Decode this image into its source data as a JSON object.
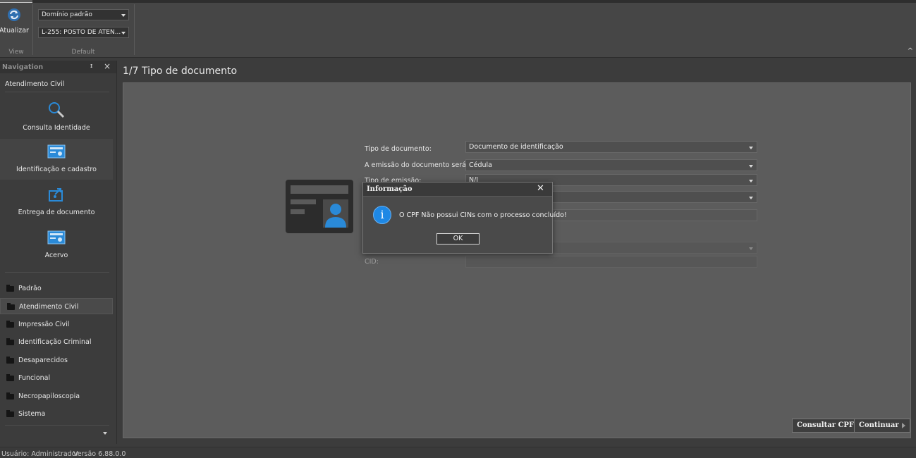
{
  "ribbon": {
    "refresh_label": "Atualizar",
    "view_group_label": "View",
    "default_group_label": "Default",
    "domain_combo_value": "Domínio padrão",
    "post_combo_value": "L-255: POSTO DE ATEN..."
  },
  "navigation": {
    "title": "Navigation",
    "section_title": "Atendimento Civil",
    "big_items": [
      {
        "label": "Consulta Identidade",
        "icon": "search-icon"
      },
      {
        "label": "Identificação e cadastro",
        "icon": "id-card-icon"
      },
      {
        "label": "Entrega de documento",
        "icon": "document-delivery-icon"
      },
      {
        "label": "Acervo",
        "icon": "id-card-icon"
      }
    ],
    "folders": [
      {
        "label": "Padrão"
      },
      {
        "label": "Atendimento Civil",
        "selected": true
      },
      {
        "label": "Impressão Civil"
      },
      {
        "label": "Identificação Criminal"
      },
      {
        "label": "Desaparecidos"
      },
      {
        "label": "Funcional"
      },
      {
        "label": "Necropapiloscopia"
      },
      {
        "label": "Sistema"
      }
    ]
  },
  "main": {
    "page_title": "1/7 Tipo de documento",
    "form": {
      "tipo_documento_label": "Tipo de documento:",
      "tipo_documento_value": "Documento de identificação",
      "emissao_label": "A emissão do documento será em:",
      "emissao_value": "Cédula",
      "tipo_emissao_label": "Tipo de emissão:",
      "tipo_emissao_value": "N/I",
      "cid_label": "CID:"
    },
    "consultar_cpf_label": "Consultar CPF",
    "continuar_label": "Continuar"
  },
  "dialog": {
    "title": "Informação",
    "message": "O CPF Não possui CINs com o processo concluído!",
    "ok_label": "OK"
  },
  "statusbar": {
    "user": "Usuário: Administrador",
    "version": "Versão 6.88.0.0"
  },
  "colors": {
    "accent_blue": "#1e88e5",
    "background": "#3c3c3c",
    "content_panel": "#5c5c5c"
  }
}
